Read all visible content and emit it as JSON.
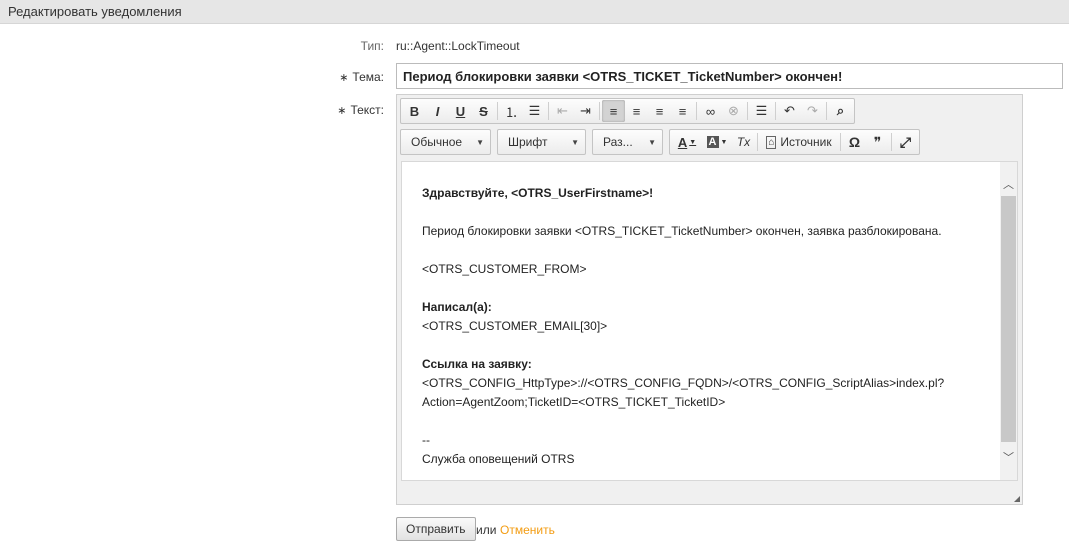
{
  "header": {
    "title": "Редактировать уведомления"
  },
  "form": {
    "type_label": "Тип:",
    "type_value": "ru::Agent::LockTimeout",
    "subject_required": "∗",
    "subject_label": "Тема:",
    "subject_value": "Период блокировки заявки <OTRS_TICKET_TicketNumber> окончен!",
    "text_required": "∗",
    "text_label": "Текст:"
  },
  "toolbar": {
    "row1": [
      {
        "name": "bold-icon",
        "glyph": "B"
      },
      {
        "name": "italic-icon",
        "glyph": "I"
      },
      {
        "name": "underline-icon",
        "glyph": "U"
      },
      {
        "name": "strike-icon",
        "glyph": "S"
      },
      {
        "name": "numbered-list-icon",
        "glyph": "⒈"
      },
      {
        "name": "bulleted-list-icon",
        "glyph": "☰"
      },
      {
        "name": "outdent-icon",
        "glyph": "⇤"
      },
      {
        "name": "indent-icon",
        "glyph": "⇥"
      },
      {
        "name": "align-left-icon",
        "glyph": "≡"
      },
      {
        "name": "align-center-icon",
        "glyph": "≡"
      },
      {
        "name": "align-right-icon",
        "glyph": "≡"
      },
      {
        "name": "justify-icon",
        "glyph": "≡"
      },
      {
        "name": "link-icon",
        "glyph": "∞"
      },
      {
        "name": "unlink-icon",
        "glyph": "⊗"
      },
      {
        "name": "horizontal-rule-icon",
        "glyph": "☰"
      },
      {
        "name": "undo-icon",
        "glyph": "↶"
      },
      {
        "name": "redo-icon",
        "glyph": "↷"
      },
      {
        "name": "find-icon",
        "glyph": "⌕"
      }
    ],
    "format_combo": "Обычное",
    "font_combo": "Шрифт",
    "size_combo": "Раз...",
    "text_color_glyph": "A",
    "bg_color_glyph": "A",
    "remove_format_glyph": "Tx",
    "source_label": "Источник",
    "special_char_glyph": "Ω",
    "blockquote_glyph": "❞",
    "maximize_glyph": "⤢"
  },
  "editor_body": {
    "greeting": "Здравствуйте, <OTRS_UserFirstname>!",
    "line1": "Период блокировки заявки <OTRS_TICKET_TicketNumber> окончен, заявка разблокирована.",
    "customer_from": "<OTRS_CUSTOMER_FROM>",
    "wrote_label": "Написал(а):",
    "customer_email": "<OTRS_CUSTOMER_EMAIL[30]>",
    "link_label": "Ссылка на заявку:",
    "link_line1": "<OTRS_CONFIG_HttpType>://<OTRS_CONFIG_FQDN>/<OTRS_CONFIG_ScriptAlias>index.pl?",
    "link_line2": "Action=AgentZoom;TicketID=<OTRS_TICKET_TicketID>",
    "signature_sep": "--",
    "signature": "Служба оповещений OTRS"
  },
  "actions": {
    "submit_label": "Отправить",
    "or_text": "или",
    "cancel_label": "Отменить"
  },
  "colors": {
    "header_bg": "#e6e6e6",
    "cancel_link": "#f39c12"
  }
}
